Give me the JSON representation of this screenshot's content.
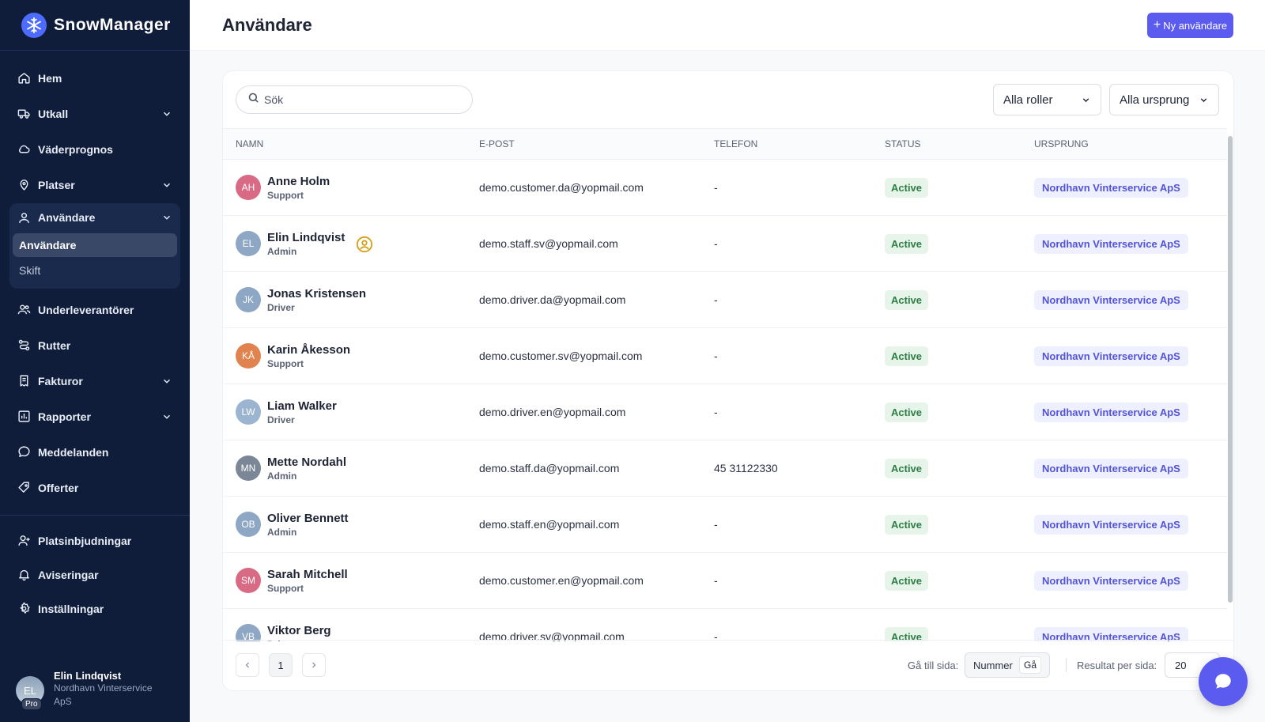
{
  "app": {
    "name": "SnowManager"
  },
  "sidebar": {
    "items": [
      {
        "label": "Hem",
        "icon": "home-icon",
        "chevron": false
      },
      {
        "label": "Utkall",
        "icon": "truck-icon",
        "chevron": true
      },
      {
        "label": "Väderprognos",
        "icon": "cloud-icon",
        "chevron": false
      },
      {
        "label": "Platser",
        "icon": "pin-icon",
        "chevron": true
      }
    ],
    "active_group": {
      "label": "Användare",
      "icon": "user-icon",
      "subitems": [
        {
          "label": "Användare",
          "active": true
        },
        {
          "label": "Skift",
          "active": false
        }
      ]
    },
    "items_after": [
      {
        "label": "Underleverantörer",
        "icon": "users-icon",
        "chevron": false
      },
      {
        "label": "Rutter",
        "icon": "route-icon",
        "chevron": false
      },
      {
        "label": "Fakturor",
        "icon": "invoice-icon",
        "chevron": true
      },
      {
        "label": "Rapporter",
        "icon": "chart-icon",
        "chevron": true
      },
      {
        "label": "Meddelanden",
        "icon": "message-icon",
        "chevron": false
      },
      {
        "label": "Offerter",
        "icon": "offer-icon",
        "chevron": false
      }
    ],
    "bottom_items": [
      {
        "label": "Platsinbjudningar",
        "icon": "invite-icon"
      },
      {
        "label": "Aviseringar",
        "icon": "bell-icon"
      },
      {
        "label": "Inställningar",
        "icon": "gear-icon"
      }
    ],
    "user": {
      "initials": "EL",
      "badge": "Pro",
      "name": "Elin Lindqvist",
      "org": "Nordhavn Vinterservice ApS"
    }
  },
  "header": {
    "title": "Användare",
    "new_button": "Ny användare"
  },
  "filters": {
    "search_placeholder": "Sök",
    "role_select": "Alla roller",
    "origin_select": "Alla ursprung"
  },
  "table": {
    "columns": [
      "NAMN",
      "E-POST",
      "TELEFON",
      "STATUS",
      "URSPRUNG"
    ],
    "rows": [
      {
        "initials": "AH",
        "name": "Anne Holm",
        "role": "Support",
        "email": "demo.customer.da@yopmail.com",
        "phone": "-",
        "status": "Active",
        "origin": "Nordhavn Vinterservice ApS",
        "color": "#d96a86",
        "admin_icon": false
      },
      {
        "initials": "EL",
        "name": "Elin Lindqvist",
        "role": "Admin",
        "email": "demo.staff.sv@yopmail.com",
        "phone": "-",
        "status": "Active",
        "origin": "Nordhavn Vinterservice ApS",
        "color": "#8ea7c4",
        "admin_icon": true
      },
      {
        "initials": "JK",
        "name": "Jonas Kristensen",
        "role": "Driver",
        "email": "demo.driver.da@yopmail.com",
        "phone": "-",
        "status": "Active",
        "origin": "Nordhavn Vinterservice ApS",
        "color": "#8ea7c4",
        "admin_icon": false
      },
      {
        "initials": "KÅ",
        "name": "Karin Åkesson",
        "role": "Support",
        "email": "demo.customer.sv@yopmail.com",
        "phone": "-",
        "status": "Active",
        "origin": "Nordhavn Vinterservice ApS",
        "color": "#e0834f",
        "admin_icon": false
      },
      {
        "initials": "LW",
        "name": "Liam Walker",
        "role": "Driver",
        "email": "demo.driver.en@yopmail.com",
        "phone": "-",
        "status": "Active",
        "origin": "Nordhavn Vinterservice ApS",
        "color": "#9bb4cf",
        "admin_icon": false
      },
      {
        "initials": "MN",
        "name": "Mette Nordahl",
        "role": "Admin",
        "email": "demo.staff.da@yopmail.com",
        "phone": "45 31122330",
        "status": "Active",
        "origin": "Nordhavn Vinterservice ApS",
        "color": "#7b8797",
        "admin_icon": false
      },
      {
        "initials": "OB",
        "name": "Oliver Bennett",
        "role": "Admin",
        "email": "demo.staff.en@yopmail.com",
        "phone": "-",
        "status": "Active",
        "origin": "Nordhavn Vinterservice ApS",
        "color": "#8ea7c4",
        "admin_icon": false
      },
      {
        "initials": "SM",
        "name": "Sarah Mitchell",
        "role": "Support",
        "email": "demo.customer.en@yopmail.com",
        "phone": "-",
        "status": "Active",
        "origin": "Nordhavn Vinterservice ApS",
        "color": "#d96a86",
        "admin_icon": false
      },
      {
        "initials": "VB",
        "name": "Viktor Berg",
        "role": "Driver",
        "email": "demo.driver.sv@yopmail.com",
        "phone": "-",
        "status": "Active",
        "origin": "Nordhavn Vinterservice ApS",
        "color": "#8ea7c4",
        "admin_icon": false
      }
    ]
  },
  "pagination": {
    "current_page": "1",
    "goto_label": "Gå till sida:",
    "goto_placeholder": "Nummer",
    "goto_button": "Gå",
    "per_page_label": "Resultat per sida:",
    "per_page_value": "20"
  },
  "colors": {
    "sidebar_bg": "#0f1d3a",
    "accent": "#5b5bf0",
    "active_green": "#2e7d45",
    "origin_purple": "#5353d8"
  }
}
